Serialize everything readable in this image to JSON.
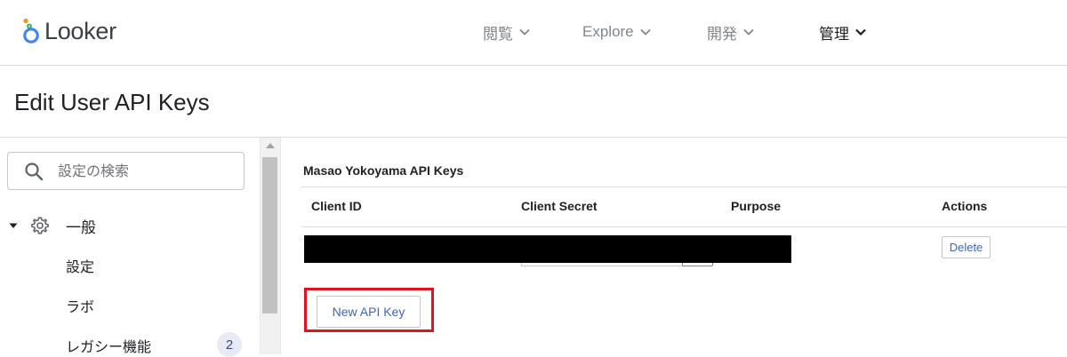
{
  "brand": {
    "name": "Looker"
  },
  "nav": {
    "items": [
      {
        "label": "閲覧",
        "icon": "chevron-down-icon",
        "active": false
      },
      {
        "label": "Explore",
        "icon": "chevron-down-icon",
        "active": false
      },
      {
        "label": "開発",
        "icon": "chevron-down-icon",
        "active": false
      },
      {
        "label": "管理",
        "icon": "chevron-down-icon",
        "active": true
      }
    ]
  },
  "page": {
    "title": "Edit User API Keys"
  },
  "sidebar": {
    "search": {
      "placeholder": "設定の検索",
      "value": ""
    },
    "group": {
      "label": "一般",
      "icon": "gear-icon",
      "expanded": true
    },
    "items": [
      {
        "label": "設定"
      },
      {
        "label": "ラボ"
      },
      {
        "label": "レガシー機能",
        "badge": "2"
      }
    ]
  },
  "api_keys": {
    "section_title": "Masao Yokoyama API Keys",
    "columns": [
      "Client ID",
      "Client Secret",
      "Purpose",
      "Actions"
    ],
    "rows": [
      {
        "client_id": "[redacted]",
        "client_secret": "[redacted]",
        "purpose": "",
        "action_label": "Delete"
      }
    ],
    "new_key_label": "New API Key"
  },
  "colors": {
    "accent": "#3c66c4",
    "highlight": "#e0151c",
    "logo_orange": "#f29900",
    "logo_blue": "#4285f4"
  }
}
